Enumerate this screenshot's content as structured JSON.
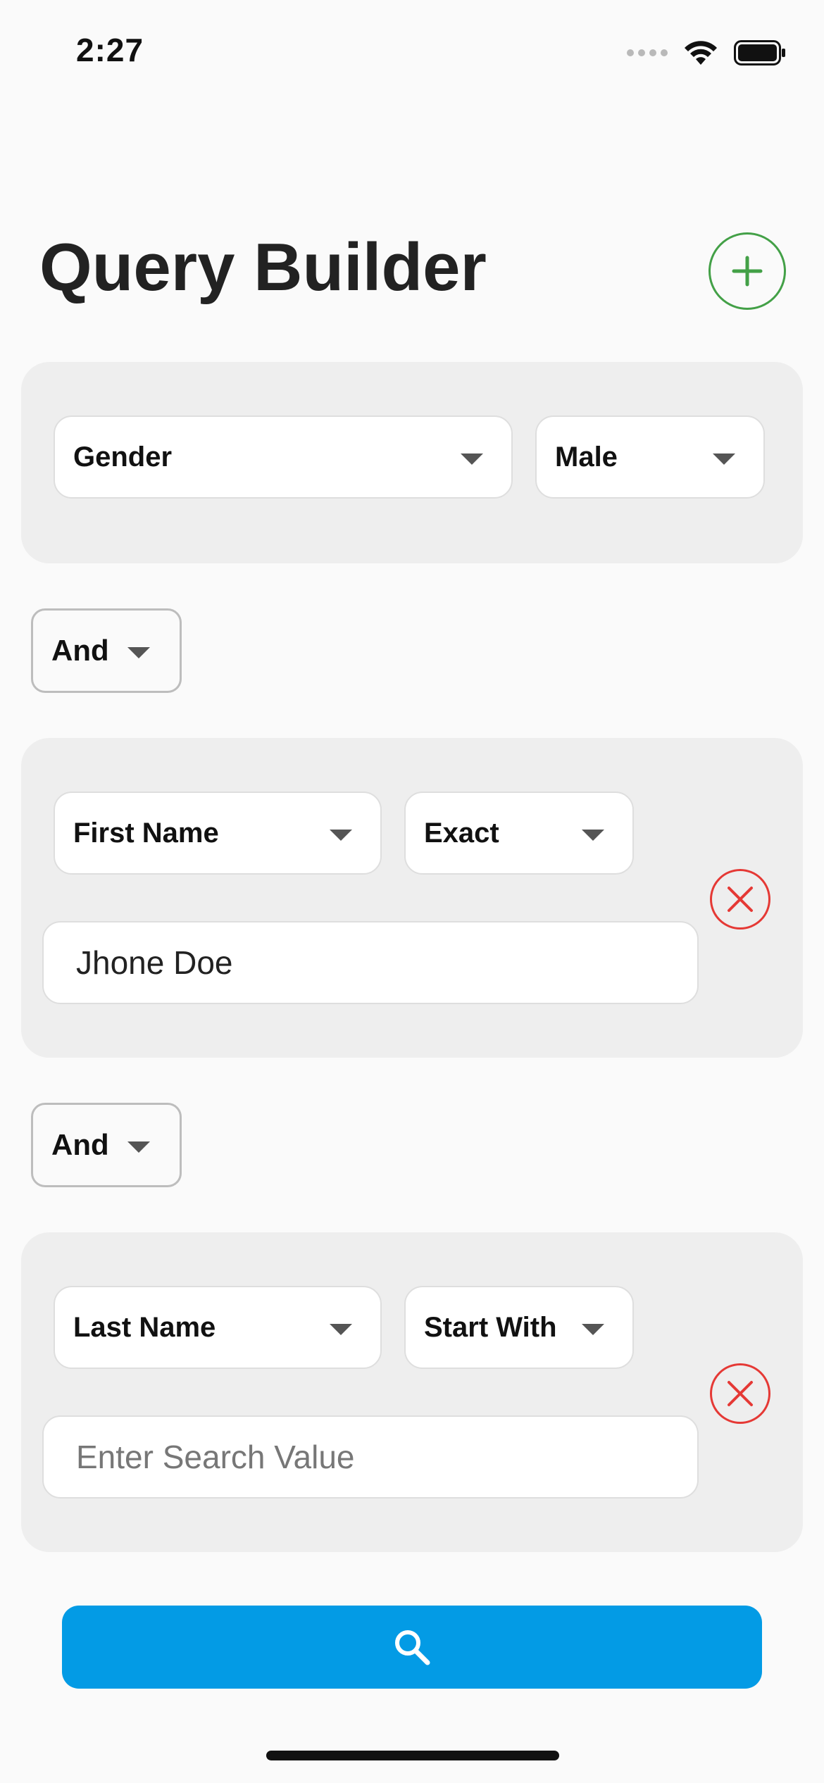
{
  "status_bar": {
    "time": "2:27"
  },
  "header": {
    "title": "Query Builder",
    "add_icon": "plus-icon",
    "accent_color": "#43a047"
  },
  "conditions": [
    {
      "field": "Gender",
      "operator": "Male"
    },
    {
      "field": "First Name",
      "operator": "Exact",
      "value": "Jhone Doe",
      "placeholder": "Enter Search Value",
      "remove_icon": "close-icon"
    },
    {
      "field": "Last Name",
      "operator": "Start With",
      "value": "",
      "placeholder": "Enter Search Value",
      "remove_icon": "close-icon"
    }
  ],
  "connectors": [
    {
      "label": "And"
    },
    {
      "label": "And"
    }
  ],
  "search_button": {
    "icon": "search-icon",
    "color": "#039be5"
  },
  "colors": {
    "remove": "#e53935",
    "card_background": "#eeeeee"
  }
}
